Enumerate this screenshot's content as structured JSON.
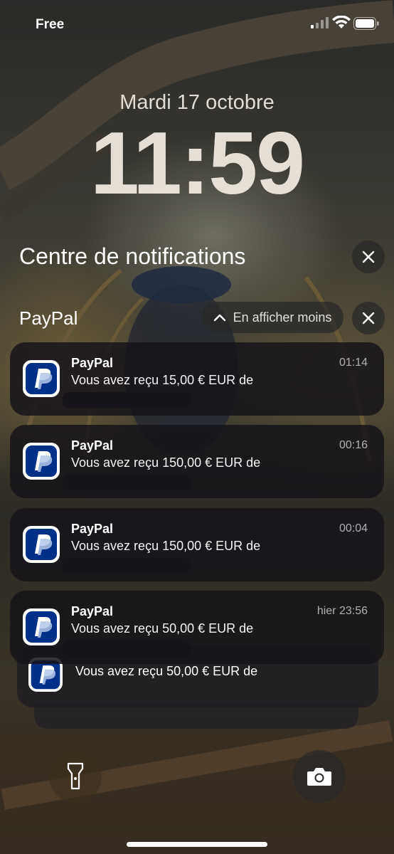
{
  "status_bar": {
    "carrier": "Free",
    "icons": [
      "cellular-signal-icon",
      "wifi-icon",
      "battery-icon"
    ]
  },
  "lockscreen": {
    "date": "Mardi 17 octobre",
    "time": "11:59"
  },
  "notification_center": {
    "title": "Centre de notifications",
    "group": {
      "app_label": "PayPal",
      "show_less_label": "En afficher moins",
      "notifications": [
        {
          "app": "PayPal",
          "message": "Vous avez reçu 15,00 € EUR de",
          "time": "01:14"
        },
        {
          "app": "PayPal",
          "message": "Vous avez reçu 150,00 € EUR de",
          "time": "00:16"
        },
        {
          "app": "PayPal",
          "message": "Vous avez reçu 150,00 € EUR de",
          "time": "00:04"
        },
        {
          "app": "PayPal",
          "message": "Vous avez reçu 50,00 € EUR de",
          "time": "hier 23:56"
        }
      ],
      "stacked_preview": {
        "message": "Vous avez reçu 50,00 € EUR de"
      }
    }
  },
  "quick_actions": {
    "left": "flashlight-icon",
    "right": "camera-icon"
  },
  "colors": {
    "paypal_dark": "#003087",
    "paypal_light": "#009cde"
  }
}
